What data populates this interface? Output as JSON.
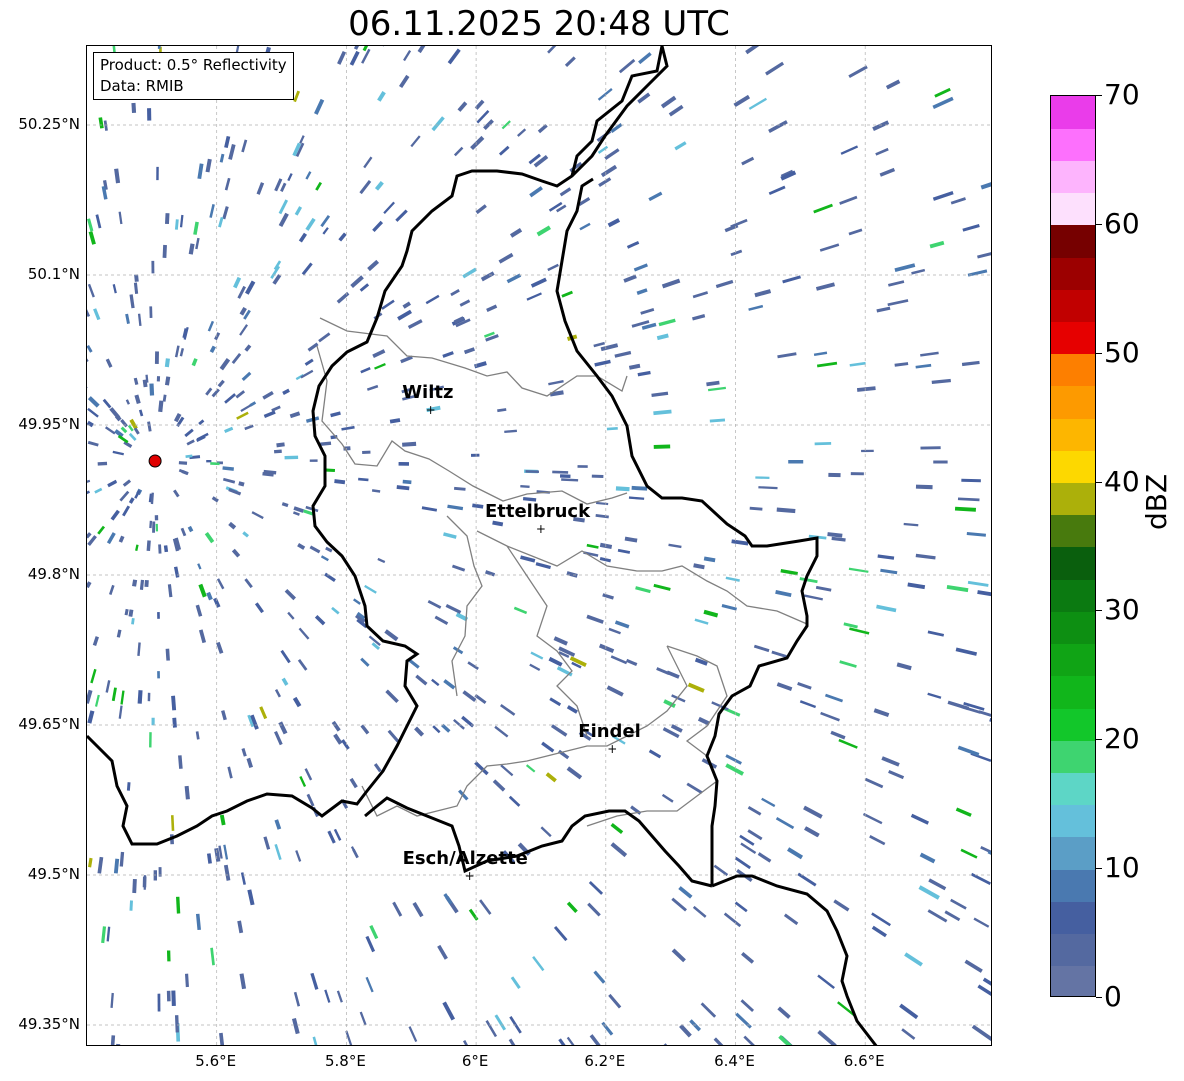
{
  "title": "06.11.2025 20:48 UTC",
  "info": {
    "product": "Product: 0.5° Reflectivity",
    "source": "Data: RMIB"
  },
  "axes": {
    "lat_ticks": [
      "50.25°N",
      "50.1°N",
      "49.95°N",
      "49.8°N",
      "49.65°N",
      "49.5°N",
      "49.35°N"
    ],
    "lon_ticks": [
      "5.6°E",
      "5.8°E",
      "6°E",
      "6.2°E",
      "6.4°E",
      "6.6°E"
    ],
    "lat_values": [
      50.25,
      50.1,
      49.95,
      49.8,
      49.65,
      49.5,
      49.35
    ],
    "lon_values": [
      5.6,
      5.8,
      6.0,
      6.2,
      6.4,
      6.6
    ],
    "lon_range": [
      5.4,
      6.8
    ],
    "lat_range": [
      49.3,
      50.3
    ]
  },
  "cities": [
    {
      "name": "Wiltz",
      "lon": 5.93,
      "lat": 49.966
    },
    {
      "name": "Ettelbruck",
      "lon": 6.1,
      "lat": 49.847
    },
    {
      "name": "Findel",
      "lon": 6.21,
      "lat": 49.627
    },
    {
      "name": "Esch/Alzette",
      "lon": 5.99,
      "lat": 49.5
    }
  ],
  "radar_site": {
    "lon": 5.505,
    "lat": 49.914
  },
  "colorbar": {
    "label": "dBZ",
    "ticks": [
      "0",
      "10",
      "20",
      "30",
      "40",
      "50",
      "60",
      "70"
    ],
    "min": 0,
    "max": 70,
    "step": 2.5,
    "colors": [
      "#6474a4",
      "#5469a0",
      "#455fa0",
      "#4a79b0",
      "#5b9ec6",
      "#64c0db",
      "#5dd6c6",
      "#3ed470",
      "#12c72a",
      "#11b61b",
      "#10a415",
      "#0d8f12",
      "#0b7a11",
      "#0a5f0d",
      "#487a0d",
      "#acb00a",
      "#fdd800",
      "#fdb600",
      "#fd9a00",
      "#fd7f00",
      "#e60000",
      "#c10000",
      "#9c0000",
      "#760000",
      "#fde0fd",
      "#fdb4fd",
      "#fd70fd",
      "#ea3cea"
    ]
  },
  "colors": {
    "border": "#000000",
    "canton_border": "#808080",
    "grid": "#b0b0b0",
    "radar_marker": "#e00000"
  }
}
